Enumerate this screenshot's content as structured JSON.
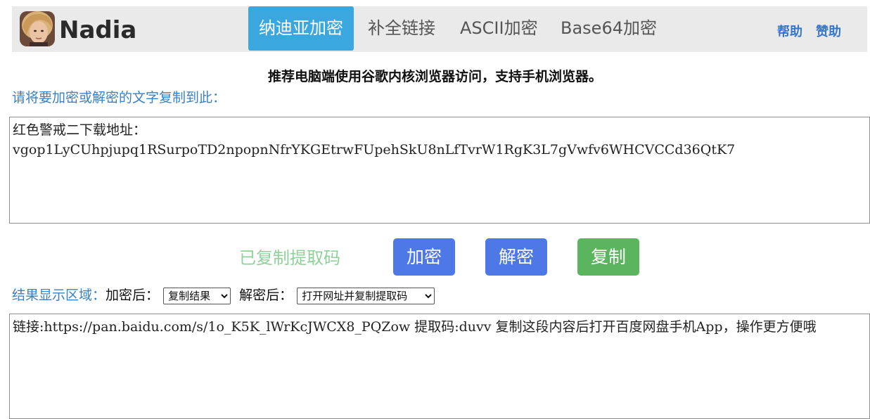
{
  "header": {
    "logo_text": "Nadia",
    "tabs": [
      {
        "label": "纳迪亚加密",
        "active": true
      },
      {
        "label": "补全链接",
        "active": false
      },
      {
        "label": "ASCII加密",
        "active": false
      },
      {
        "label": "Base64加密",
        "active": false
      }
    ],
    "links": {
      "help": "帮助",
      "sponsor": "赞助"
    }
  },
  "notice": "推荐电脑端使用谷歌内核浏览器访问，支持手机浏览器。",
  "input_section": {
    "prompt": "请将要加密或解密的文字复制到此：",
    "value": "红色警戒二下载地址：\nvgop1LyCUhpjupq1RSurpoTD2npopnNfrYKGEtrwFUpehSkU8nLfTvrW1RgK3L7gVwfv6WHCVCCd36QtK7"
  },
  "actions": {
    "status": "已复制提取码",
    "encrypt": "加密",
    "decrypt": "解密",
    "copy": "复制"
  },
  "result_section": {
    "label": "结果显示区域：",
    "encrypt_after_label": "加密后：",
    "encrypt_after_selected": "复制结果",
    "decrypt_after_label": "解密后：",
    "decrypt_after_selected": "打开网址并复制提取码",
    "value": "链接:https://pan.baidu.com/s/1o_K5K_lWrKcJWCX8_PQZow 提取码:duvv 复制这段内容后打开百度网盘手机App，操作更方便哦"
  },
  "colors": {
    "active_tab": "#3aa7df",
    "nav_bg": "#eaeaea",
    "link_blue": "#3a76c8",
    "button_blue": "#4d78e6",
    "button_green": "#5ab55e",
    "status_green": "#8fd19a"
  }
}
